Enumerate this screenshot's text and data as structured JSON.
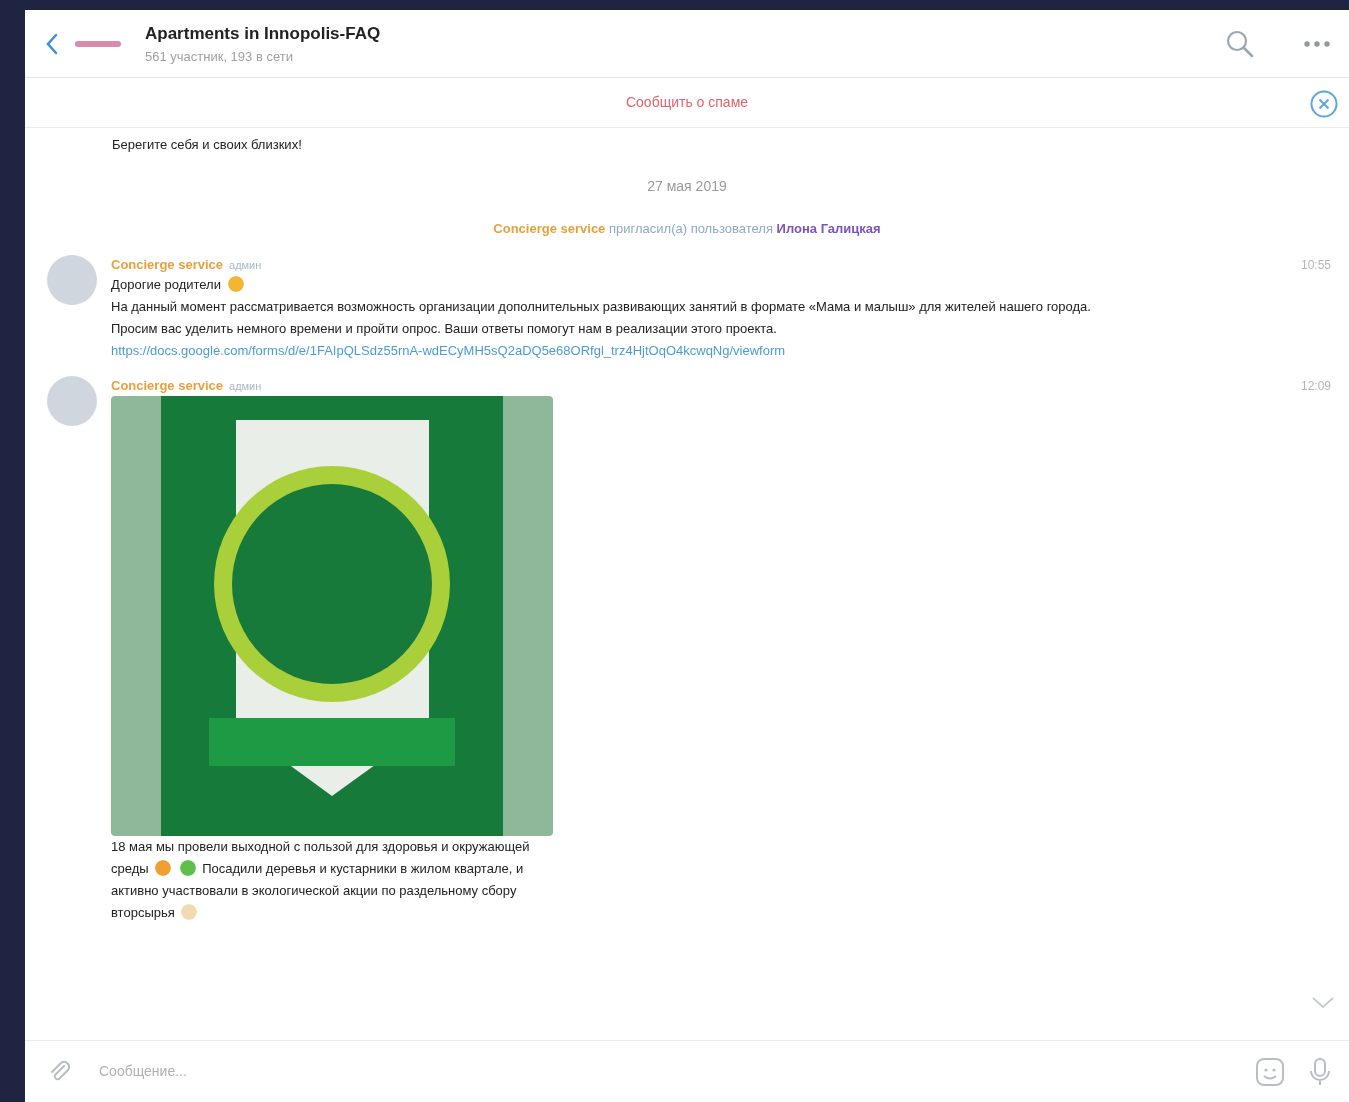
{
  "header": {
    "title": "Apartments in Innopolis-FAQ",
    "subtitle": "561 участник, 193 в сети"
  },
  "spam_bar": {
    "label": "Сообщить о спаме"
  },
  "messages": [
    {
      "kind": "text",
      "parts": [
        {
          "kind": "text",
          "text": "Берегите себя и своих близких!"
        }
      ]
    },
    {
      "kind": "date",
      "text": "27 мая 2019"
    },
    {
      "kind": "service",
      "actor": "Concierge service",
      "action": "пригласил(а) пользователя",
      "target": "Илона Галицкая"
    },
    {
      "kind": "post",
      "sender": "Concierge service",
      "role": "админ",
      "time": "10:55",
      "parts": [
        {
          "kind": "text",
          "text": "Дорогие родители"
        },
        {
          "kind": "emoji",
          "color": "#f2b632"
        },
        {
          "kind": "break"
        },
        {
          "kind": "text",
          "text": "На данный момент рассматривается возможность организации дополнительных развивающих занятий в формате «Мама и малыш» для жителей нашего города."
        },
        {
          "kind": "break"
        },
        {
          "kind": "text",
          "text": "Просим вас уделить немного времени и пройти опрос. Ваши ответы помогут нам в реализации этого проекта."
        },
        {
          "kind": "break"
        },
        {
          "kind": "link",
          "text": "https://docs.google.com/forms/d/e/1FAIpQLSdz55rnA-wdECyMH5sQ2aDQ5e68ORfgl_trz4HjtOqO4kcwqNg/viewform"
        }
      ]
    },
    {
      "kind": "photo",
      "sender": "Concierge service",
      "role": "админ",
      "time": "12:09",
      "parts": [
        {
          "kind": "text",
          "text": "18 мая мы провели выходной с пользой для здоровья и окружающей среды"
        },
        {
          "kind": "emoji",
          "color": "#f0a030"
        },
        {
          "kind": "emoji",
          "color": "#5cc04a"
        },
        {
          "kind": "text",
          "text": "Посадили деревья и кустарники в жилом квартале, и активно участвовали в экологической акции по раздельному сбору вторсырья"
        },
        {
          "kind": "emoji",
          "color": "#f3d9b0"
        }
      ]
    }
  ],
  "composer": {
    "placeholder": "Сообщение..."
  }
}
